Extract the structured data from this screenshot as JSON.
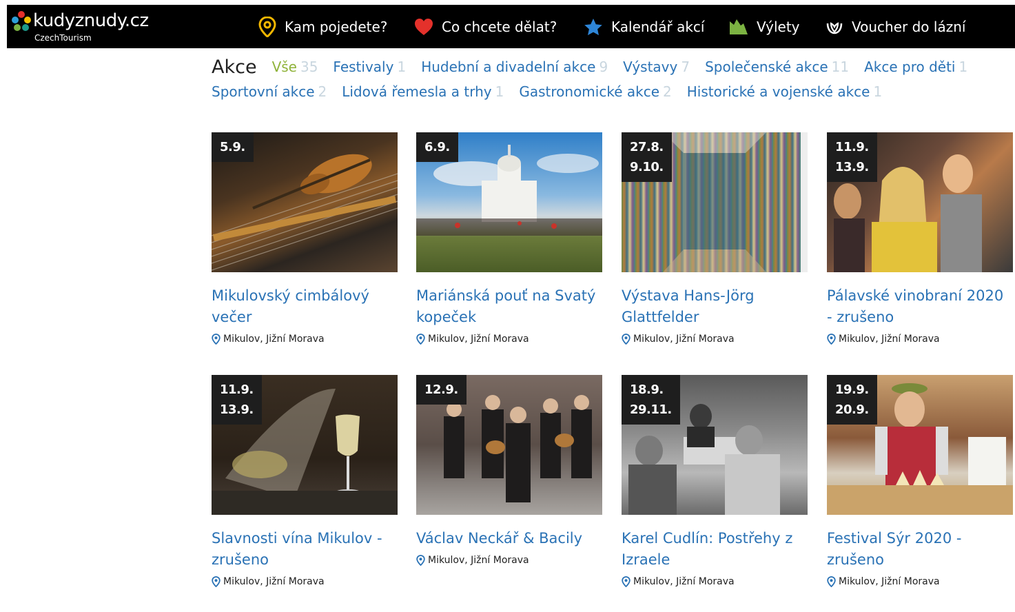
{
  "header": {
    "logo_text": "kudyznudy.cz",
    "logo_sub": "CzechTourism",
    "nav": [
      {
        "label": "Kam pojedete?",
        "icon": "map-pin-icon"
      },
      {
        "label": "Co chcete dělat?",
        "icon": "heart-icon"
      },
      {
        "label": "Kalendář akcí",
        "icon": "star-icon"
      },
      {
        "label": "Výlety",
        "icon": "mountain-icon"
      },
      {
        "label": "Voucher do lázní",
        "icon": "spa-icon"
      }
    ]
  },
  "filters": {
    "title": "Akce",
    "row1": [
      {
        "label": "Vše",
        "count": "35",
        "active": true
      },
      {
        "label": "Festivaly",
        "count": "1"
      },
      {
        "label": "Hudební a divadelní akce",
        "count": "9"
      },
      {
        "label": "Výstavy",
        "count": "7"
      },
      {
        "label": "Společenské akce",
        "count": "11"
      },
      {
        "label": "Akce pro děti",
        "count": "1"
      }
    ],
    "row2": [
      {
        "label": "Sportovní akce",
        "count": "2"
      },
      {
        "label": "Lidová řemesla a trhy",
        "count": "1"
      },
      {
        "label": "Gastronomické akce",
        "count": "2"
      },
      {
        "label": "Historické a vojenské akce",
        "count": "1"
      }
    ]
  },
  "events": [
    {
      "date1": "5.9.",
      "date2": "",
      "title": "Mikulovský cimbálový večer",
      "location": "Mikulov, Jižní Morava"
    },
    {
      "date1": "6.9.",
      "date2": "",
      "title": "Mariánská pouť na Svatý kopeček",
      "location": "Mikulov, Jižní Morava"
    },
    {
      "date1": "27.8.",
      "date2": "9.10.",
      "title": "Výstava Hans-Jörg Glattfelder",
      "location": "Mikulov, Jižní Morava"
    },
    {
      "date1": "11.9.",
      "date2": "13.9.",
      "title": "Pálavské vinobraní 2020 - zrušeno",
      "location": "Mikulov, Jižní Morava"
    },
    {
      "date1": "11.9.",
      "date2": "13.9.",
      "title": "Slavnosti vína Mikulov - zrušeno",
      "location": "Mikulov, Jižní Morava"
    },
    {
      "date1": "12.9.",
      "date2": "",
      "title": "Václav Neckář & Bacily",
      "location": "Mikulov, Jižní Morava"
    },
    {
      "date1": "18.9.",
      "date2": "29.11.",
      "title": "Karel Cudlín: Postřehy z Izraele",
      "location": "Mikulov, Jižní Morava"
    },
    {
      "date1": "19.9.",
      "date2": "20.9.",
      "title": "Festival Sýr 2020 - zrušeno",
      "location": "Mikulov, Jižní Morava"
    }
  ],
  "colors": {
    "link": "#2a72b5",
    "active": "#8fb33a",
    "count": "#c9d6df",
    "header_bg": "#000000"
  }
}
